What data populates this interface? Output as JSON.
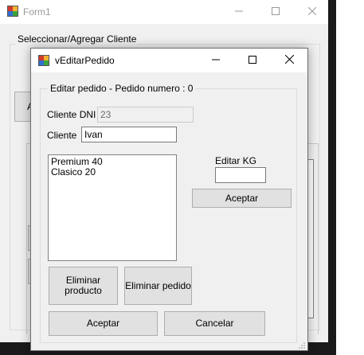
{
  "background_form": {
    "title": "Form1",
    "group_label": "Seleccionar/Agregar Cliente",
    "partial_button_label": "A",
    "partial_label": "A"
  },
  "dialog": {
    "title": "vEditarPedido",
    "group_label": "Editar pedido - Pedido numero : 0",
    "cliente_dni_label": "Cliente DNI",
    "cliente_dni_value": "23",
    "cliente_label": "Cliente",
    "cliente_value": "Ivan",
    "products": [
      "Premium 40",
      "Clasico 20"
    ],
    "editar_kg_label": "Editar KG",
    "editar_kg_value": "",
    "aceptar_kg_label": "Aceptar",
    "eliminar_producto_label": "Eliminar producto",
    "eliminar_pedido_label": "Eliminar pedido",
    "aceptar_label": "Aceptar",
    "cancelar_label": "Cancelar"
  },
  "icons": {
    "app": "winforms-app-icon",
    "minimize": "minimize-icon",
    "maximize": "maximize-icon",
    "close": "close-icon",
    "resize": "resize-grip-icon"
  }
}
